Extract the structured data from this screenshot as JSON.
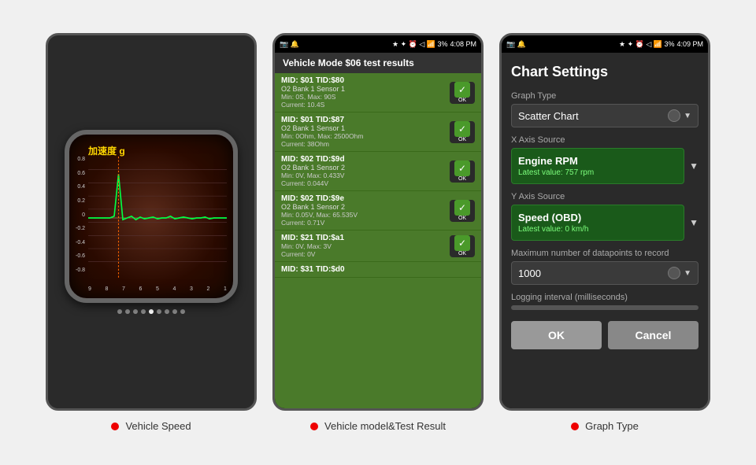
{
  "panels": [
    {
      "id": "panel1",
      "label": "Vehicle Speed",
      "graph": {
        "title": "加速度 g",
        "y_labels": [
          "0.8",
          "0.6",
          "0.4",
          "0.2",
          "0",
          "-0.2",
          "-0.4",
          "-0.6",
          "-0.8"
        ],
        "x_labels": [
          "9",
          "8",
          "7",
          "6",
          "5",
          "4",
          "3",
          "2",
          "1"
        ]
      },
      "dots": [
        false,
        false,
        false,
        false,
        true,
        false,
        false,
        false,
        false
      ]
    },
    {
      "id": "panel2",
      "label": "Vehicle model&Test Result",
      "status_bar": {
        "left": "📱",
        "time": "4:08 PM",
        "right": "3%"
      },
      "header": "Vehicle Mode $06 test results",
      "rows": [
        {
          "mid": "MID: $01 TID:$80",
          "bank": "O2 Bank 1 Sensor 1",
          "values": "Min: 0S, Max: 90S\nCurrent: 10.4S",
          "ok": true
        },
        {
          "mid": "MID: $01 TID:$87",
          "bank": "O2 Bank 1 Sensor 1",
          "values": "Min: 0Ohm, Max: 2500Ohm\nCurrent: 38Ohm",
          "ok": true
        },
        {
          "mid": "MID: $02 TID:$9d",
          "bank": "O2 Bank 1 Sensor 2",
          "values": "Min: 0V, Max: 0.433V\nCurrent: 0.044V",
          "ok": true
        },
        {
          "mid": "MID: $02 TID:$9e",
          "bank": "O2 Bank 1 Sensor 2",
          "values": "Min: 0.05V, Max: 65.535V\nCurrent: 0.71V",
          "ok": true
        },
        {
          "mid": "MID: $21 TID:$a1",
          "bank": "",
          "values": "Min: 0V, Max: 3V\nCurrent: 0V",
          "ok": true
        },
        {
          "mid": "MID: $31 TID:$d0",
          "bank": "",
          "values": "",
          "ok": false
        }
      ]
    },
    {
      "id": "panel3",
      "label": "Graph Type",
      "status_bar": {
        "time": "4:09 PM",
        "right": "3%"
      },
      "title": "Chart Settings",
      "graph_type_label": "Graph Type",
      "graph_type_value": "Scatter Chart",
      "x_axis_label": "X Axis Source",
      "x_axis_value": "Engine RPM",
      "x_axis_sub": "Latest value: 757 rpm",
      "y_axis_label": "Y Axis Source",
      "y_axis_value": "Speed (OBD)",
      "y_axis_sub": "Latest value: 0 km/h",
      "max_datapoints_label": "Maximum number of datapoints to record",
      "max_datapoints_value": "1000",
      "logging_label": "Logging interval (milliseconds)",
      "ok_label": "OK",
      "cancel_label": "Cancel"
    }
  ]
}
